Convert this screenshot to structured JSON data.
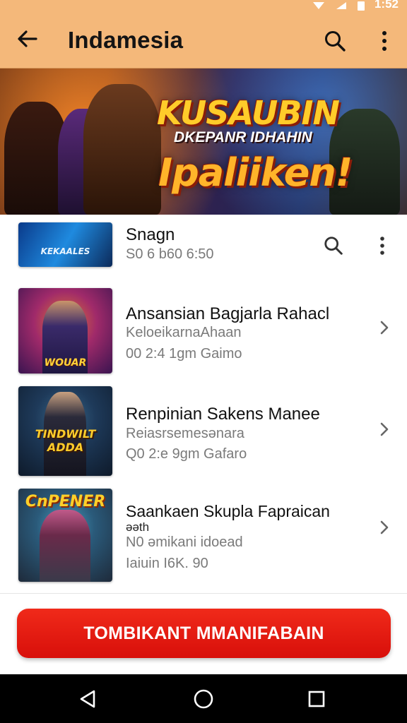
{
  "app_bar": {
    "title": "Indamesia",
    "status_time": "1:52",
    "icons": [
      "back-arrow-icon",
      "search-icon",
      "more-vert-icon"
    ],
    "color": "#f4b87a"
  },
  "banner": {
    "title": "KUSAUBIN",
    "subtitle": "DKEPANR IDHAHIN",
    "tagline": "Ipaliiken!"
  },
  "list": {
    "items": [
      {
        "title": "Snagn",
        "line1": "S0 6 b60 6:50",
        "line2": "",
        "line3": "",
        "thumb_label": "KEKAALES",
        "trailing": [
          "search-icon",
          "more-vert-icon"
        ]
      },
      {
        "title": "Ansansian Bagjarla Rahacl",
        "line1": "KeloeikarnаAhaan",
        "line2": "00 2:4 1gm  Gaimo",
        "line3": "",
        "thumb_label": "WOUAR",
        "trailing": [
          "chevron-right-icon"
        ]
      },
      {
        "title": "Renpinian Sakens Manee",
        "line1": "Reiasrsemesənara",
        "line2": "Q0 2:е 9gm  Gafaro",
        "line3": "",
        "thumb_label": "TINDWILT ADDA",
        "trailing": [
          "chevron-right-icon"
        ]
      },
      {
        "title": "Saankaen Skupla Fapraican",
        "line1": "əəth",
        "line2": "N0 əmikani idoead",
        "line3": "Iaiuin I6K. 90",
        "thumb_label": "CnPENER",
        "trailing": [
          "chevron-right-icon"
        ]
      }
    ]
  },
  "cta": {
    "label": "TOMBIKANT MMANIFABAIN",
    "color": "#e81c12"
  },
  "navbar": {
    "icons": [
      "back-triangle-icon",
      "home-circle-icon",
      "recents-square-icon"
    ]
  }
}
